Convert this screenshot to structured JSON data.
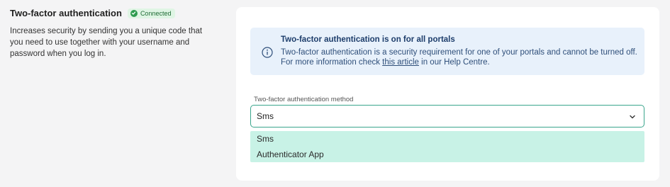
{
  "section": {
    "title": "Two-factor authentication",
    "badge": "Connected",
    "description": "Increases security by sending you a unique code that you need to use together with your username and password when you log in."
  },
  "alert": {
    "title": "Two-factor authentication is on for all portals",
    "body_before_link": "Two-factor authentication is a security requirement for one of your portals and cannot be turned off. For more information check ",
    "link_text": "this article",
    "body_after_link": " in our Help Centre."
  },
  "method": {
    "label": "Two-factor authentication method",
    "selected": "Sms",
    "options": [
      "Sms",
      "Authenticator App"
    ]
  },
  "colors": {
    "accent": "#3aa58c",
    "badge_bg": "#dff5e4",
    "alert_bg": "#e8f1fb",
    "dropdown_bg": "#c8f2e6"
  }
}
